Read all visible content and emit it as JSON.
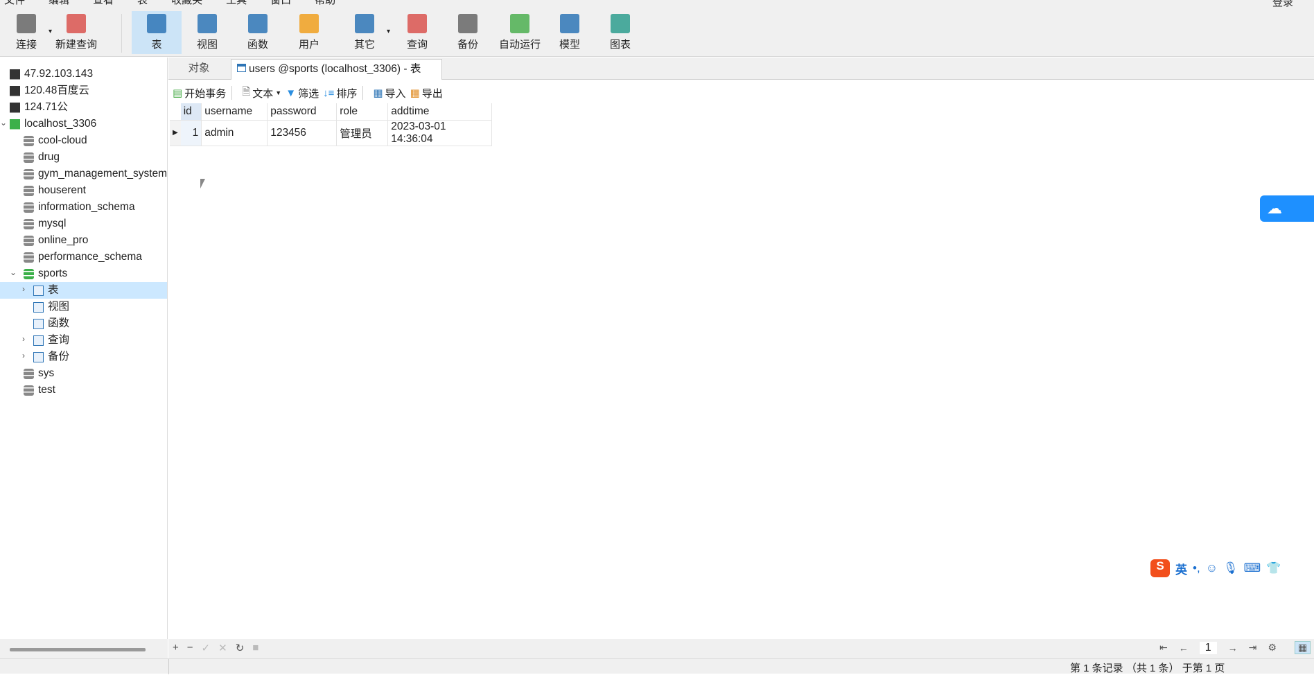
{
  "menu": [
    "文件",
    "编辑",
    "查看",
    "表",
    "收藏夹",
    "工具",
    "窗口",
    "帮助"
  ],
  "login": "登录",
  "toolbar": [
    {
      "label": "连接",
      "icon": "connect-icon",
      "color": "#666"
    },
    {
      "label": "新建查询",
      "icon": "new-query-icon",
      "color": "#d9534f"
    },
    {
      "label": "表",
      "icon": "table-icon",
      "color": "#2e75b6"
    },
    {
      "label": "视图",
      "icon": "view-icon",
      "color": "#2e75b6"
    },
    {
      "label": "函数",
      "icon": "function-icon",
      "color": "#2e75b6"
    },
    {
      "label": "用户",
      "icon": "user-icon",
      "color": "#f0a020"
    },
    {
      "label": "其它",
      "icon": "tools-icon",
      "color": "#2e75b6"
    },
    {
      "label": "查询",
      "icon": "query-icon",
      "color": "#d9534f"
    },
    {
      "label": "备份",
      "icon": "backup-icon",
      "color": "#666"
    },
    {
      "label": "自动运行",
      "icon": "schedule-icon",
      "color": "#4caf50"
    },
    {
      "label": "模型",
      "icon": "model-icon",
      "color": "#2e75b6"
    },
    {
      "label": "图表",
      "icon": "chart-icon",
      "color": "#2e9e8e"
    }
  ],
  "tree": [
    {
      "label": "47.92.103.143",
      "type": "server"
    },
    {
      "label": "120.48百度云",
      "type": "server"
    },
    {
      "label": "124.71公",
      "type": "server"
    },
    {
      "label": "localhost_3306",
      "type": "server-open"
    },
    {
      "label": "cool-cloud",
      "type": "db"
    },
    {
      "label": "drug",
      "type": "db"
    },
    {
      "label": "gym_management_system",
      "type": "db"
    },
    {
      "label": "houserent",
      "type": "db"
    },
    {
      "label": "information_schema",
      "type": "db"
    },
    {
      "label": "mysql",
      "type": "db"
    },
    {
      "label": "online_pro",
      "type": "db"
    },
    {
      "label": "performance_schema",
      "type": "db"
    },
    {
      "label": "sports",
      "type": "db-open"
    },
    {
      "label": "表",
      "type": "tables"
    },
    {
      "label": "视图",
      "type": "views"
    },
    {
      "label": "函数",
      "type": "functions"
    },
    {
      "label": "查询",
      "type": "queries"
    },
    {
      "label": "备份",
      "type": "backups"
    },
    {
      "label": "sys",
      "type": "db"
    },
    {
      "label": "test",
      "type": "db"
    }
  ],
  "tabs": {
    "objects": "对象",
    "active": "users @sports (localhost_3306) - 表"
  },
  "tabletoolbar": {
    "begin": "开始事务",
    "text": "文本",
    "filter": "筛选",
    "sort": "排序",
    "import": "导入",
    "export": "导出"
  },
  "grid": {
    "columns": [
      "id",
      "username",
      "password",
      "role",
      "addtime"
    ],
    "rows": [
      [
        "1",
        "admin",
        "123456",
        "管理员",
        "2023-03-01 14:36:04"
      ]
    ]
  },
  "pager": {
    "page": "1"
  },
  "status": "第 1 条记录 （共 1 条） 于第 1 页",
  "ime": {
    "lang": "英"
  }
}
